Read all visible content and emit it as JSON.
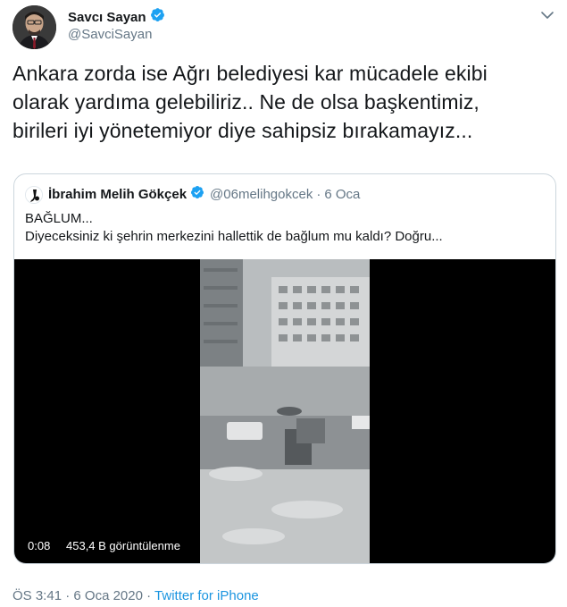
{
  "author": {
    "name": "Savcı Sayan",
    "handle": "@SavciSayan"
  },
  "tweet": {
    "text_lines": [
      "Ankara zorda ise Ağrı belediyesi kar mücadele ekibi",
      "olarak yardıma gelebiliriz..  Ne de olsa başkentimiz,",
      "birileri iyi yönetemiyor diye sahipsiz bırakamayız..."
    ]
  },
  "quoted": {
    "name": "İbrahim Melih Gökçek",
    "handle": "@06melihgokcek",
    "separator": "·",
    "date": "6 Oca",
    "text_line1": "BAĞLUM...",
    "text_line2": "Diyeceksiniz ki şehrin merkezini hallettik de bağlum mu kaldı? Doğru..."
  },
  "video": {
    "duration": "0:08",
    "views": "453,4 B görüntülenme"
  },
  "meta": {
    "time": "ÖS 3:41",
    "separator1": "·",
    "date": "6 Oca 2020",
    "separator2": "·",
    "source": "Twitter for iPhone"
  },
  "colors": {
    "verified": "#1da1f2",
    "link": "#1b95e0",
    "muted": "#657786"
  },
  "icons": {
    "verified": "verified-badge-icon",
    "caret": "chevron-down-icon"
  }
}
